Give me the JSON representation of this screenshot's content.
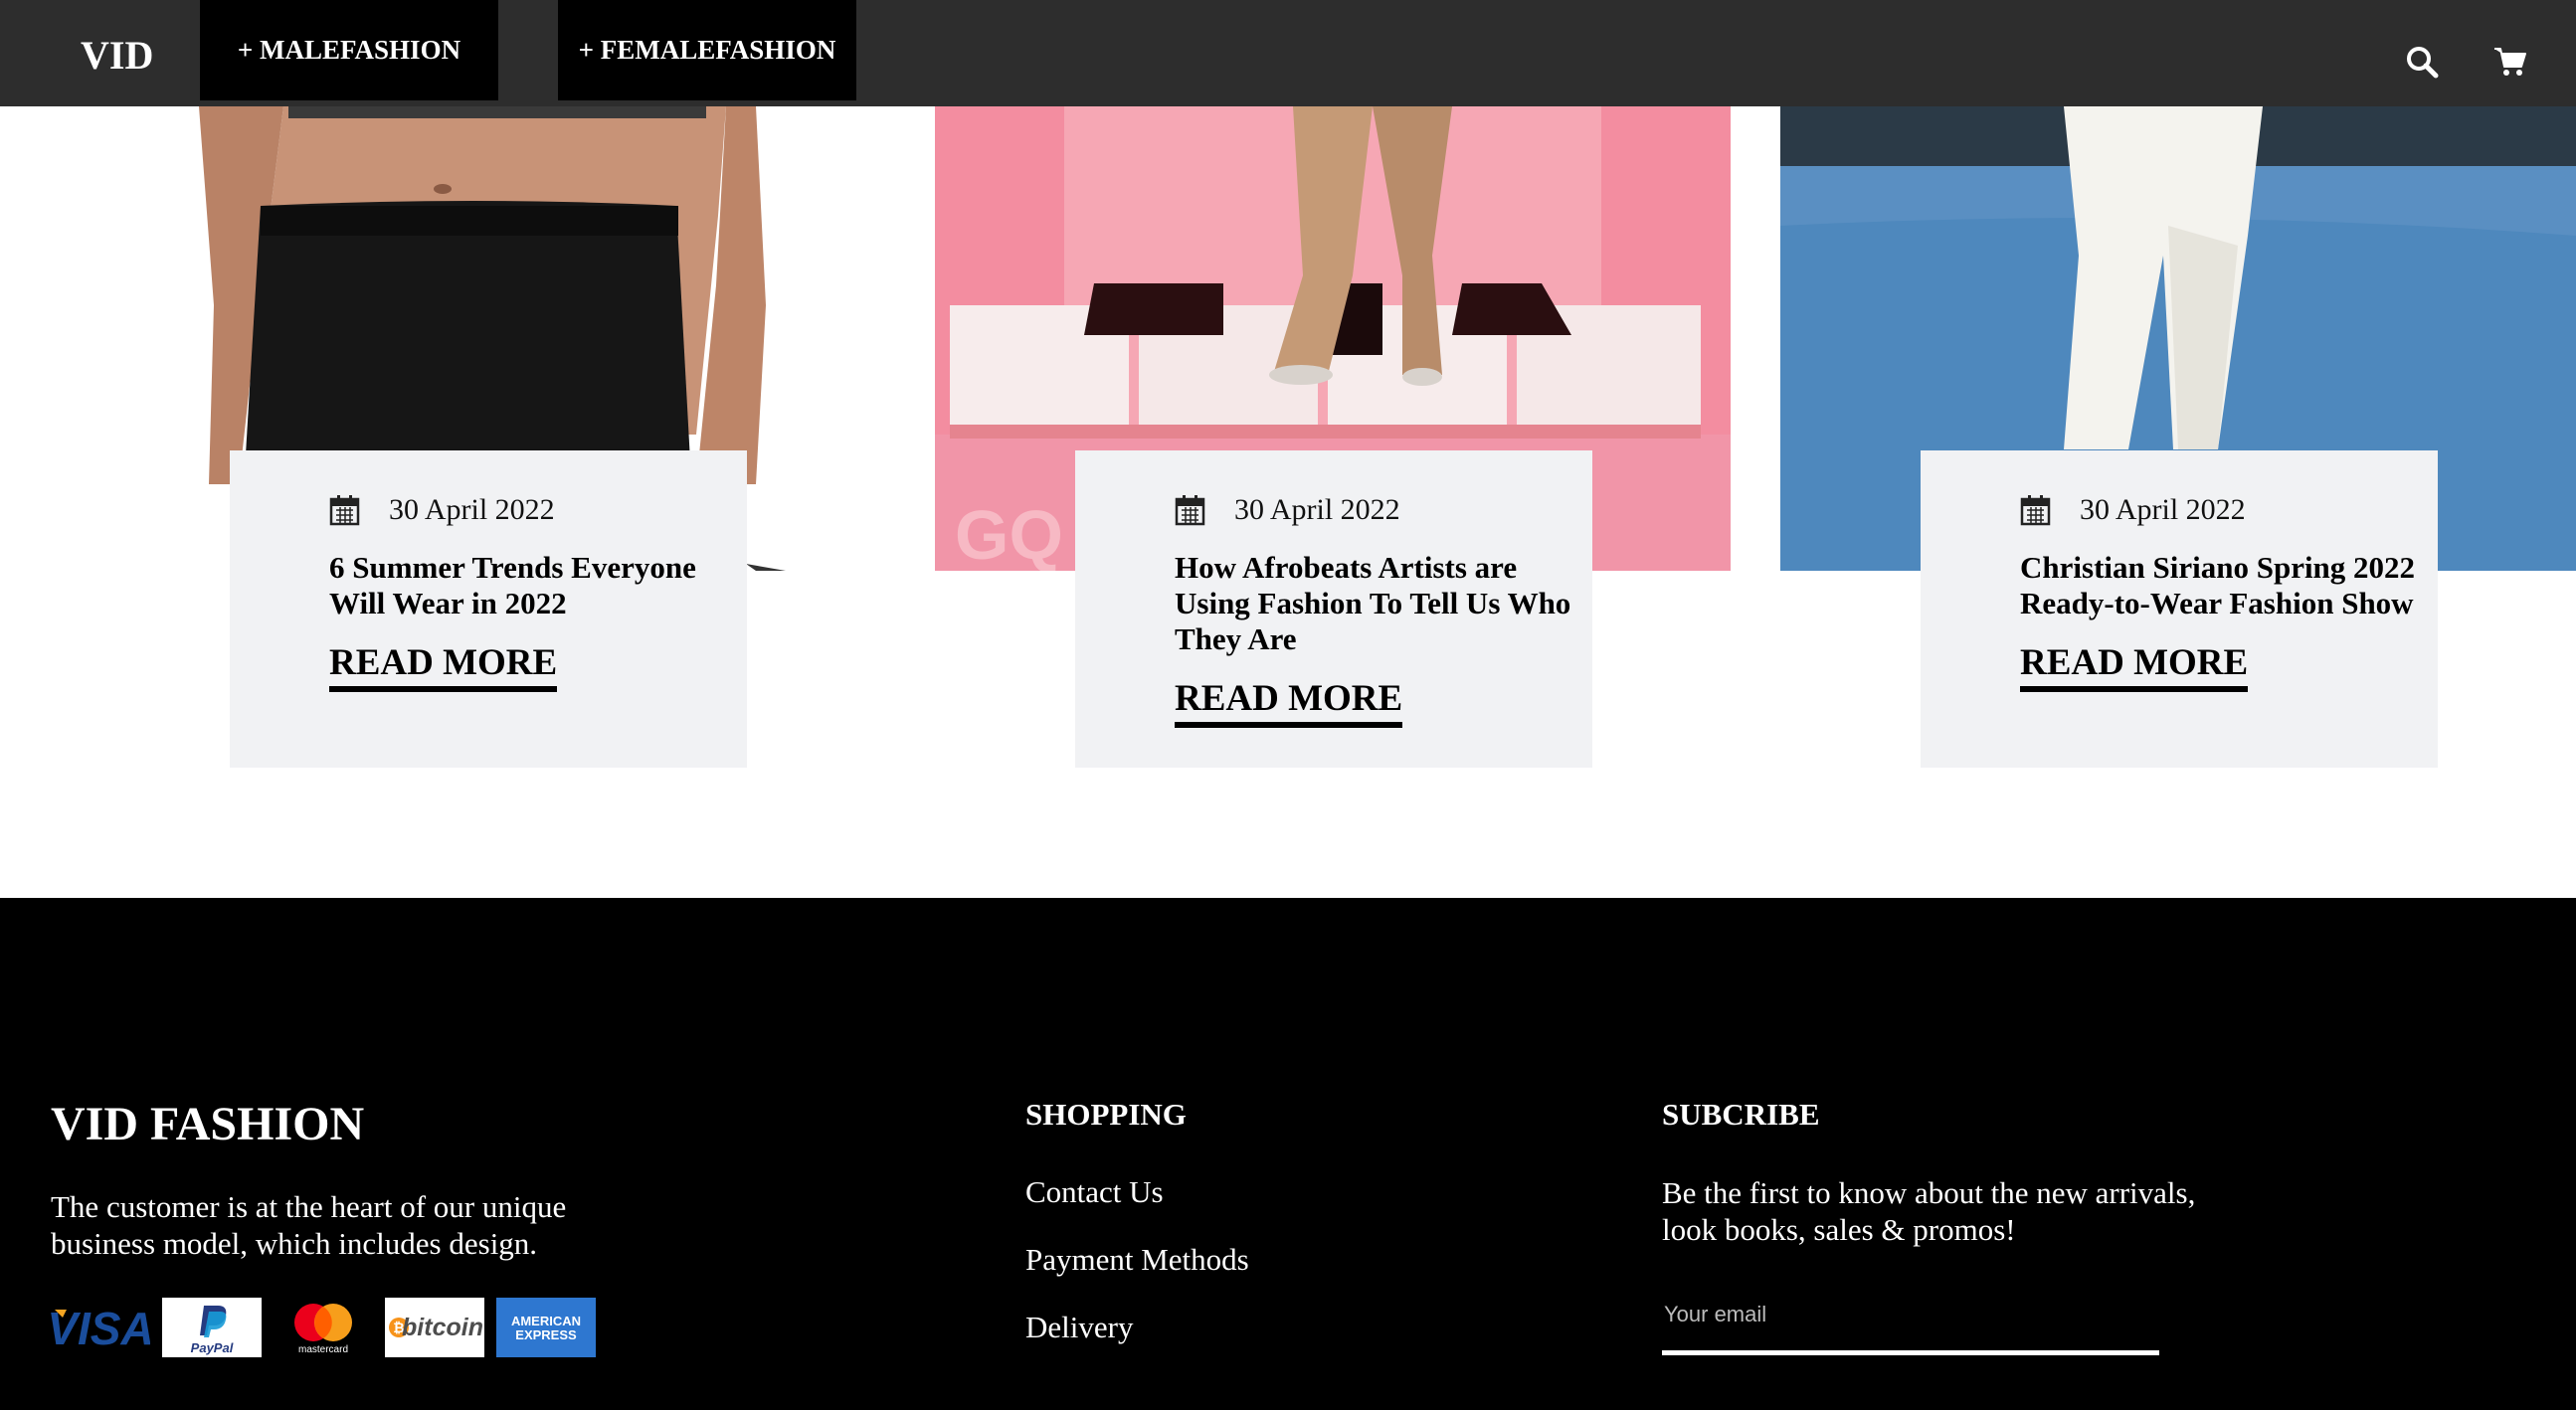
{
  "header": {
    "logo": "VID",
    "nav": [
      {
        "label": "+ MALEFASHION"
      },
      {
        "label": "+ FEMALEFASHION"
      }
    ],
    "icons": [
      "search-icon",
      "cart-icon"
    ]
  },
  "posts": [
    {
      "date": "30 April 2022",
      "title": "6 Summer Trends Everyone Will Wear in 2022",
      "cta": "READ MORE"
    },
    {
      "date": "30 April 2022",
      "title": "How Afrobeats Artists are Using Fashion To Tell Us Who They Are",
      "cta": "READ MORE"
    },
    {
      "date": "30 April 2022",
      "title": "Christian Siriano Spring 2022 Ready-to-Wear Fashion Show",
      "cta": "READ MORE"
    }
  ],
  "footer": {
    "brand": "VID FASHION",
    "description": "The customer is at the heart of our unique business model, which includes design.",
    "payments": {
      "visa": "VISA",
      "paypal": "PayPal",
      "mastercard": "mastercard",
      "bitcoin": "bitcoin",
      "amex_line1": "AMERICAN",
      "amex_line2": "EXPRESS"
    },
    "shopping": {
      "heading": "SHOPPING",
      "links": [
        "Contact Us",
        "Payment Methods",
        "Delivery"
      ]
    },
    "subscribe": {
      "heading": "SUBCRIBE",
      "description": "Be the first to know about the new arrivals, look books, sales & promos!",
      "placeholder": "Your email"
    }
  },
  "colors": {
    "header_bg": "#2d2d2d",
    "nav_bg": "#000000",
    "card_bg": "#f1f2f4",
    "footer_bg": "#000000"
  }
}
